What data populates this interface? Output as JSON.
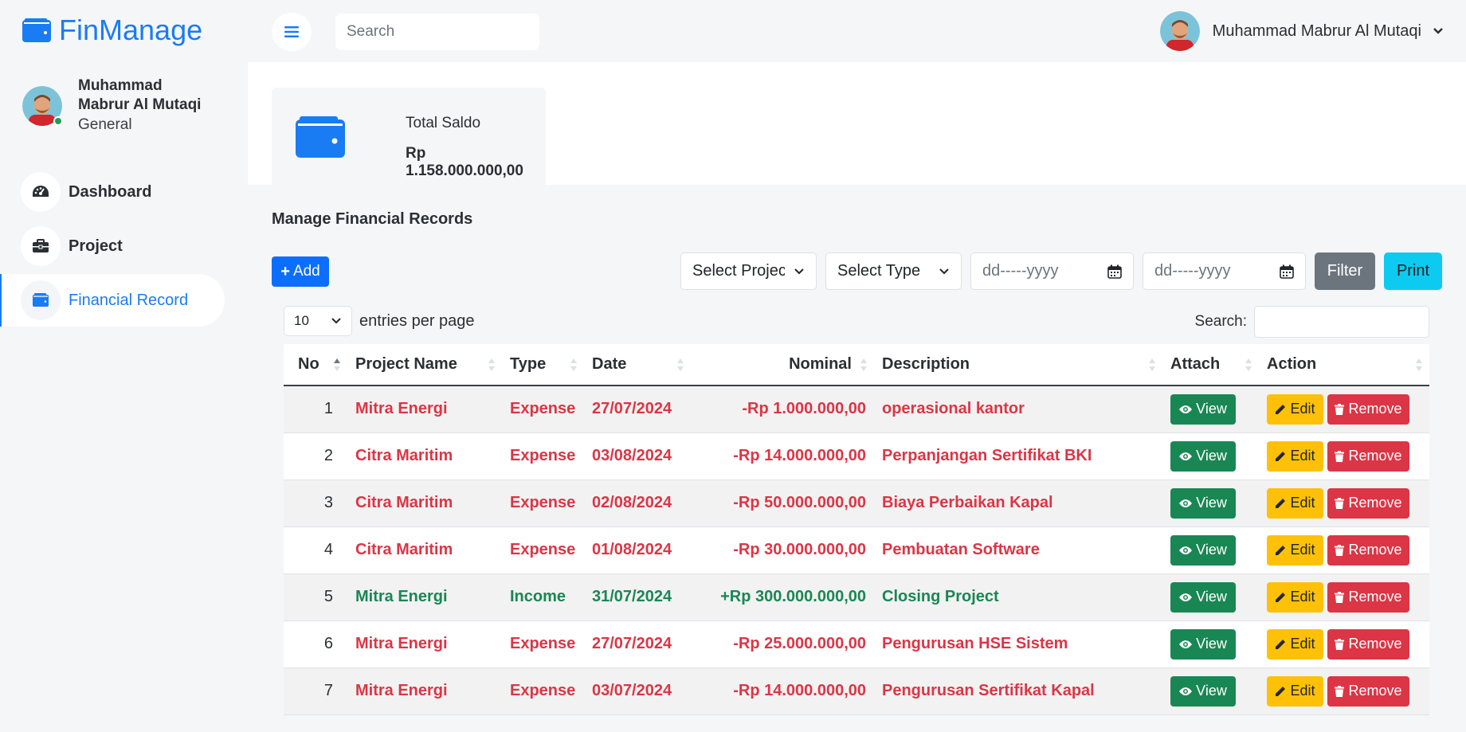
{
  "brand": {
    "name": "FinManage",
    "color": "#1a7cf2"
  },
  "profile": {
    "name": "Muhammad Mabrur Al Mutaqi",
    "role": "General"
  },
  "nav": [
    {
      "label": "Dashboard",
      "icon": "gauge-icon"
    },
    {
      "label": "Project",
      "icon": "briefcase-icon"
    },
    {
      "label": "Financial Record",
      "icon": "wallet-icon",
      "active": true
    }
  ],
  "topbar": {
    "search_placeholder": "Search",
    "user_name": "Muhammad Mabrur Al Mutaqi"
  },
  "summary": {
    "label": "Total Saldo",
    "value": "Rp 1.158.000.000,00"
  },
  "section_title": "Manage Financial Records",
  "toolbar": {
    "add_label": "Add",
    "select_project": "Select Project",
    "select_type": "Select Type",
    "date_from_placeholder": "dd-----yyyy",
    "date_to_placeholder": "dd-----yyyy",
    "filter_label": "Filter",
    "print_label": "Print"
  },
  "datatable": {
    "per_page_value": "10",
    "per_page_label": "entries per page",
    "search_label": "Search:"
  },
  "table": {
    "headers": [
      "No",
      "Project Name",
      "Type",
      "Date",
      "Nominal",
      "Description",
      "Attach",
      "Action"
    ],
    "view_label": "View",
    "edit_label": "Edit",
    "remove_label": "Remove",
    "rows": [
      {
        "no": "1",
        "project": "Mitra Energi",
        "type": "Expense",
        "date": "27/07/2024",
        "nominal": "-Rp 1.000.000,00",
        "description": "operasional kantor"
      },
      {
        "no": "2",
        "project": "Citra Maritim",
        "type": "Expense",
        "date": "03/08/2024",
        "nominal": "-Rp 14.000.000,00",
        "description": "Perpanjangan Sertifikat BKI"
      },
      {
        "no": "3",
        "project": "Citra Maritim",
        "type": "Expense",
        "date": "02/08/2024",
        "nominal": "-Rp 50.000.000,00",
        "description": "Biaya Perbaikan Kapal"
      },
      {
        "no": "4",
        "project": "Citra Maritim",
        "type": "Expense",
        "date": "01/08/2024",
        "nominal": "-Rp 30.000.000,00",
        "description": "Pembuatan Software"
      },
      {
        "no": "5",
        "project": "Mitra Energi",
        "type": "Income",
        "date": "31/07/2024",
        "nominal": "+Rp 300.000.000,00",
        "description": "Closing Project"
      },
      {
        "no": "6",
        "project": "Mitra Energi",
        "type": "Expense",
        "date": "27/07/2024",
        "nominal": "-Rp 25.000.000,00",
        "description": "Pengurusan HSE Sistem"
      },
      {
        "no": "7",
        "project": "Mitra Energi",
        "type": "Expense",
        "date": "03/07/2024",
        "nominal": "-Rp 14.000.000,00",
        "description": "Pengurusan Sertifikat Kapal"
      }
    ]
  },
  "colors": {
    "primary": "#0d6efd",
    "danger": "#dc3545",
    "success": "#198754",
    "warning": "#ffc107",
    "info": "#0dcaf0",
    "secondary": "#6c757d"
  }
}
